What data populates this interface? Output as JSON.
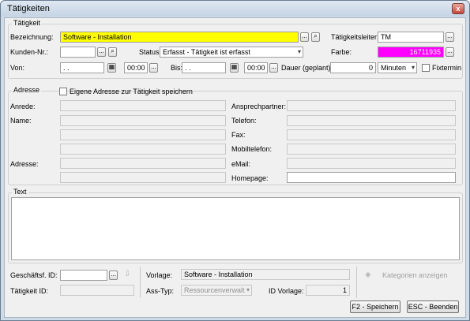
{
  "window": {
    "title": "Tätigkeiten",
    "close_glyph": "x"
  },
  "group_taetigkeit": {
    "title": "Tätigkeit",
    "bezeichnung_label": "Bezeichnung:",
    "bezeichnung_value": "Software - Installation",
    "kunden_label": "Kunden-Nr.:",
    "kunden_value": "",
    "status_label": "Status:",
    "status_value": "Erfasst - Tätigkeit ist erfasst",
    "von_label": "Von:",
    "von_date": " .  .",
    "von_time": "00:00",
    "bis_label": "Bis:",
    "bis_date": " .  .",
    "bis_time": "00:00",
    "dauer_label": "Dauer (geplant):",
    "dauer_value": "0",
    "dauer_unit": "Minuten",
    "leiter_label": "Tätigkeitsleiter:",
    "leiter_value": "TM",
    "farbe_label": "Farbe:",
    "farbe_value": "16711935",
    "farbe_color": "#ff00ff",
    "fixtermin_label": "Fixtermin",
    "bezeichnung_color": "#ffff00"
  },
  "group_adresse": {
    "title": "Adresse",
    "eigene_label": "Eigene Adresse zur Tätigkeit speichern",
    "anrede_label": "Anrede:",
    "name_label": "Name:",
    "adresse_label": "Adresse:",
    "ansprech_label": "Ansprechpartner:",
    "telefon_label": "Telefon:",
    "fax_label": "Fax:",
    "mobil_label": "Mobiltelefon:",
    "email_label": "eMail:",
    "homepage_label": "Homepage:"
  },
  "group_text": {
    "title": "Text"
  },
  "bottom": {
    "geschaeftsf_label": "Geschäftsf. ID:",
    "taetigkeit_id_label": "Tätigkeit ID:",
    "vorlage_label": "Vorlage:",
    "vorlage_value": "Software - Installation",
    "ass_typ_label": "Ass-Typ:",
    "ass_typ_value": "Ressourcenverwalt",
    "id_vorlage_label": "ID Vorlage:",
    "id_vorlage_value": "1",
    "kategorien_label": "Kategorien anzeigen",
    "speichern_label": "F2 - Speichern",
    "beenden_label": "ESC - Beenden"
  },
  "glyphs": {
    "dots": "...",
    "binoculars": "⌕",
    "calendar": "▦",
    "down": "▾",
    "arrow": "⇩",
    "diamond": "◈"
  }
}
